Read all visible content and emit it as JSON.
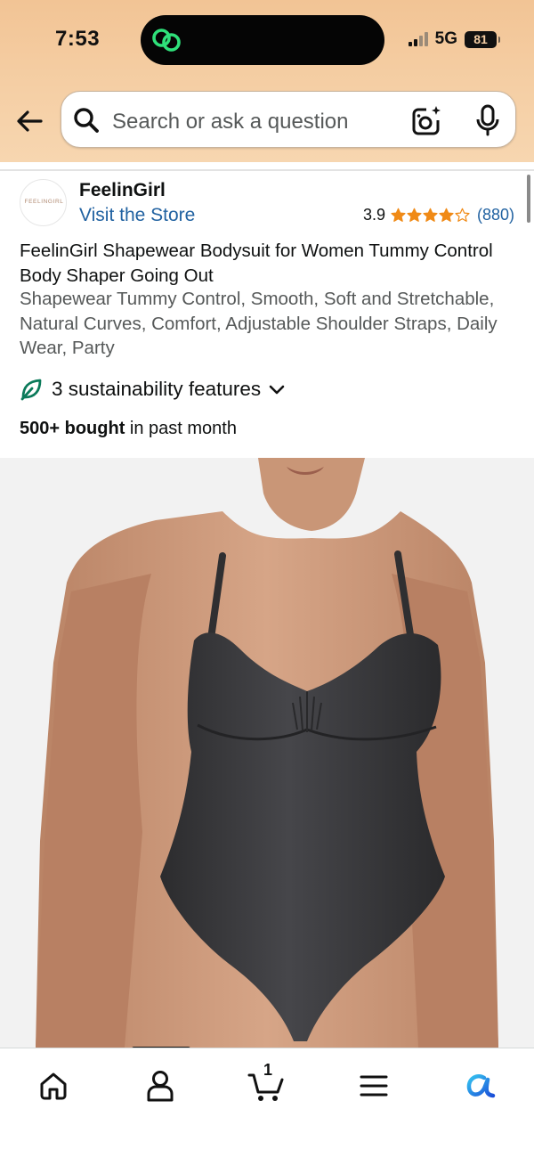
{
  "status_bar": {
    "time": "7:53",
    "network": "5G",
    "battery": "81"
  },
  "search": {
    "placeholder": "Search or ask a question"
  },
  "store": {
    "logo_text": "FEELINGIRL",
    "name": "FeelinGirl",
    "link": "Visit the Store"
  },
  "rating": {
    "value": "3.9",
    "stars": 3.9,
    "count": "(880)"
  },
  "product": {
    "title": "FeelinGirl Shapewear Bodysuit for Women Tummy Control Body Shaper Going Out",
    "subtitle": "Shapewear Tummy Control, Smooth, Soft and Stretchable, Natural Curves, Comfort, Adjustable Shoulder Straps, Daily Wear, Party",
    "sustainability": "3 sustainability features",
    "bought_bold": "500+ bought",
    "bought_rest": " in past month"
  },
  "colors": {
    "header_bg": "#f5cfa5",
    "link": "#2162a1",
    "star": "#f08a16",
    "leaf": "#0b7a5a",
    "bodysuit": "#3a3a3c",
    "skin": "#c99677"
  },
  "tabbar": {
    "cart_count": "1",
    "items": [
      "home-icon",
      "account-icon",
      "cart-icon",
      "menu-icon",
      "rufus-icon"
    ]
  }
}
